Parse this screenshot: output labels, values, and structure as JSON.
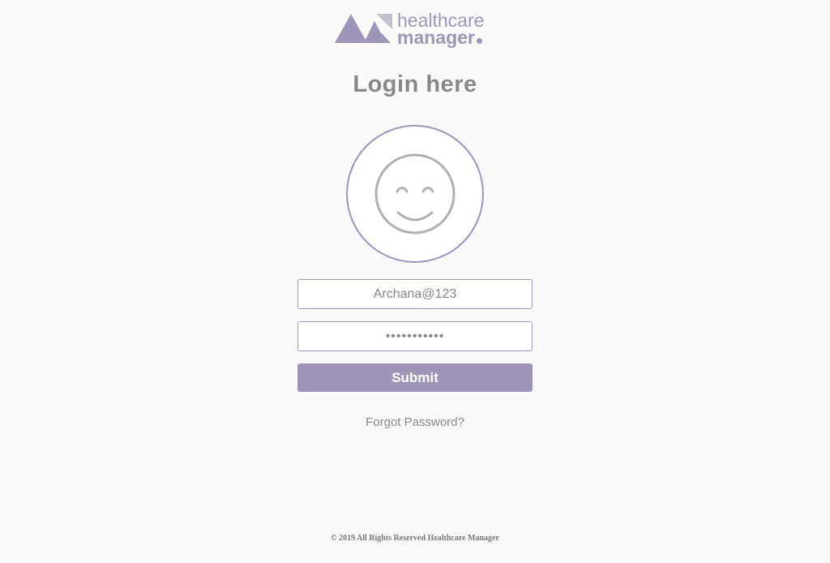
{
  "brand": {
    "line1": "healthcare",
    "line2": "manager",
    "logo_icon": "mountain-peaks-logo",
    "color": "#9e95b8"
  },
  "login": {
    "title": "Login here",
    "avatar_icon": "smiley-face-icon",
    "username": {
      "value": "Archana@123"
    },
    "password": {
      "value": "•••••••••••"
    },
    "submit_label": "Submit",
    "forgot_label": "Forgot Password?"
  },
  "footer": {
    "text": "© 2019 All Rights Reserved Healthcare Manager"
  },
  "colors": {
    "accent": "#9e95b8",
    "text": "#888888",
    "background": "#fafafa"
  }
}
